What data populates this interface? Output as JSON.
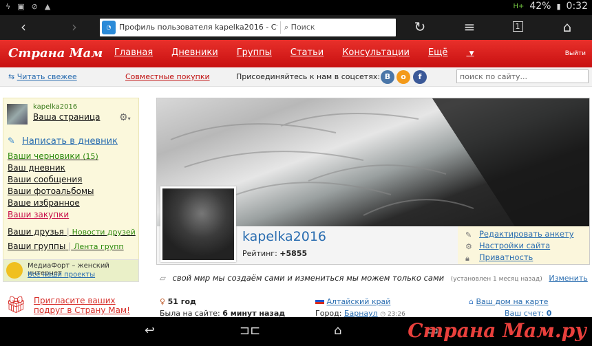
{
  "statusbar": {
    "battery": "42%",
    "time": "0:32",
    "signal": "H+"
  },
  "browser": {
    "page_title": "Профиль пользователя kapelka2016 - Ст",
    "search_placeholder": "Поиск",
    "tab_count": "1"
  },
  "site": {
    "logo": "Страна Мам",
    "nav": [
      "Главная",
      "Дневники",
      "Группы",
      "Статьи",
      "Консультации",
      "Ещё"
    ],
    "exit": "Выйти",
    "subbar": {
      "read_fresh": "Читать свежее",
      "joint_purchases": "Совместные покупки",
      "join_social": "Присоединяйтесь к нам в соцсетях:",
      "search_placeholder": "поиск по сайту..."
    },
    "social": [
      {
        "label": "B",
        "color": "#4a76a8"
      },
      {
        "label": "о",
        "color": "#f39a1a"
      },
      {
        "label": "f",
        "color": "#3b5998"
      }
    ]
  },
  "sidebar": {
    "username": "kapelka2016",
    "my_page": "Ваша страница",
    "write_diary": "Написать в дневник",
    "drafts": "Ваши черновики",
    "drafts_count": "(15)",
    "links": [
      "Ваш дневник",
      "Ваши сообщения",
      "Ваши фотоальбомы",
      "Ваше избранное"
    ],
    "purchases": "Ваши закупки",
    "friends": "Ваши друзья",
    "friends_news": "Новости друзей",
    "groups": "Ваши группы",
    "groups_feed": "Лента групп",
    "mediafort": "МедиаФорт – женский интернет",
    "all_projects": "Все наши проекты"
  },
  "profile": {
    "name": "kapelka2016",
    "rating_label": "Рейтинг:",
    "rating_value": "+5855",
    "actions": [
      "Редактировать анкету",
      "Настройки сайта",
      "Приватность"
    ],
    "status": "свой мир мы создаём сами и измениться мы можем только сами",
    "status_time": "(установлен 1 месяц назад)",
    "change": "Изменить",
    "age": "51 год",
    "last_seen_label": "Была на сайте:",
    "last_seen": "6 минут назад",
    "region": "Алтайский край",
    "city_label": "Город:",
    "city": "Барнаул",
    "city_time": "23:26",
    "home_map": "Ваш дом на карте",
    "account_label": "Ваш счет:",
    "account_value": "0"
  },
  "invite": {
    "text": "Пригласите ваших подруг в Страну Мам!"
  },
  "watermark": "Страна Мам.ру"
}
